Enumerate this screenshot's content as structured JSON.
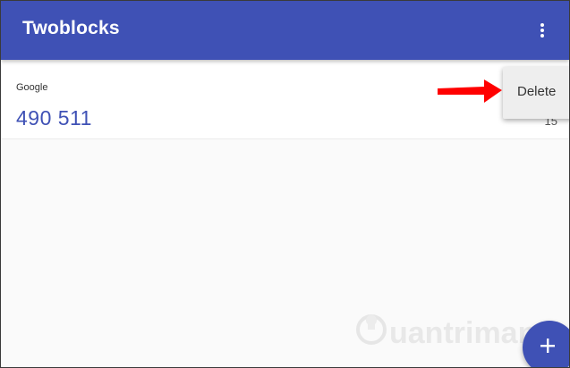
{
  "app_bar": {
    "title": "Twoblocks",
    "more_icon": "more-vert-icon",
    "color": "#3f51b5"
  },
  "accounts": [
    {
      "name": "Google",
      "code": "490 511",
      "seconds_remaining": "15"
    }
  ],
  "context_menu": {
    "items": [
      {
        "label": "Delete"
      }
    ]
  },
  "annotation": {
    "arrow_color": "#ff0000"
  },
  "watermark": {
    "text": "uantrimang",
    "icon": "bulb-icon"
  },
  "fab": {
    "icon": "plus-icon"
  }
}
